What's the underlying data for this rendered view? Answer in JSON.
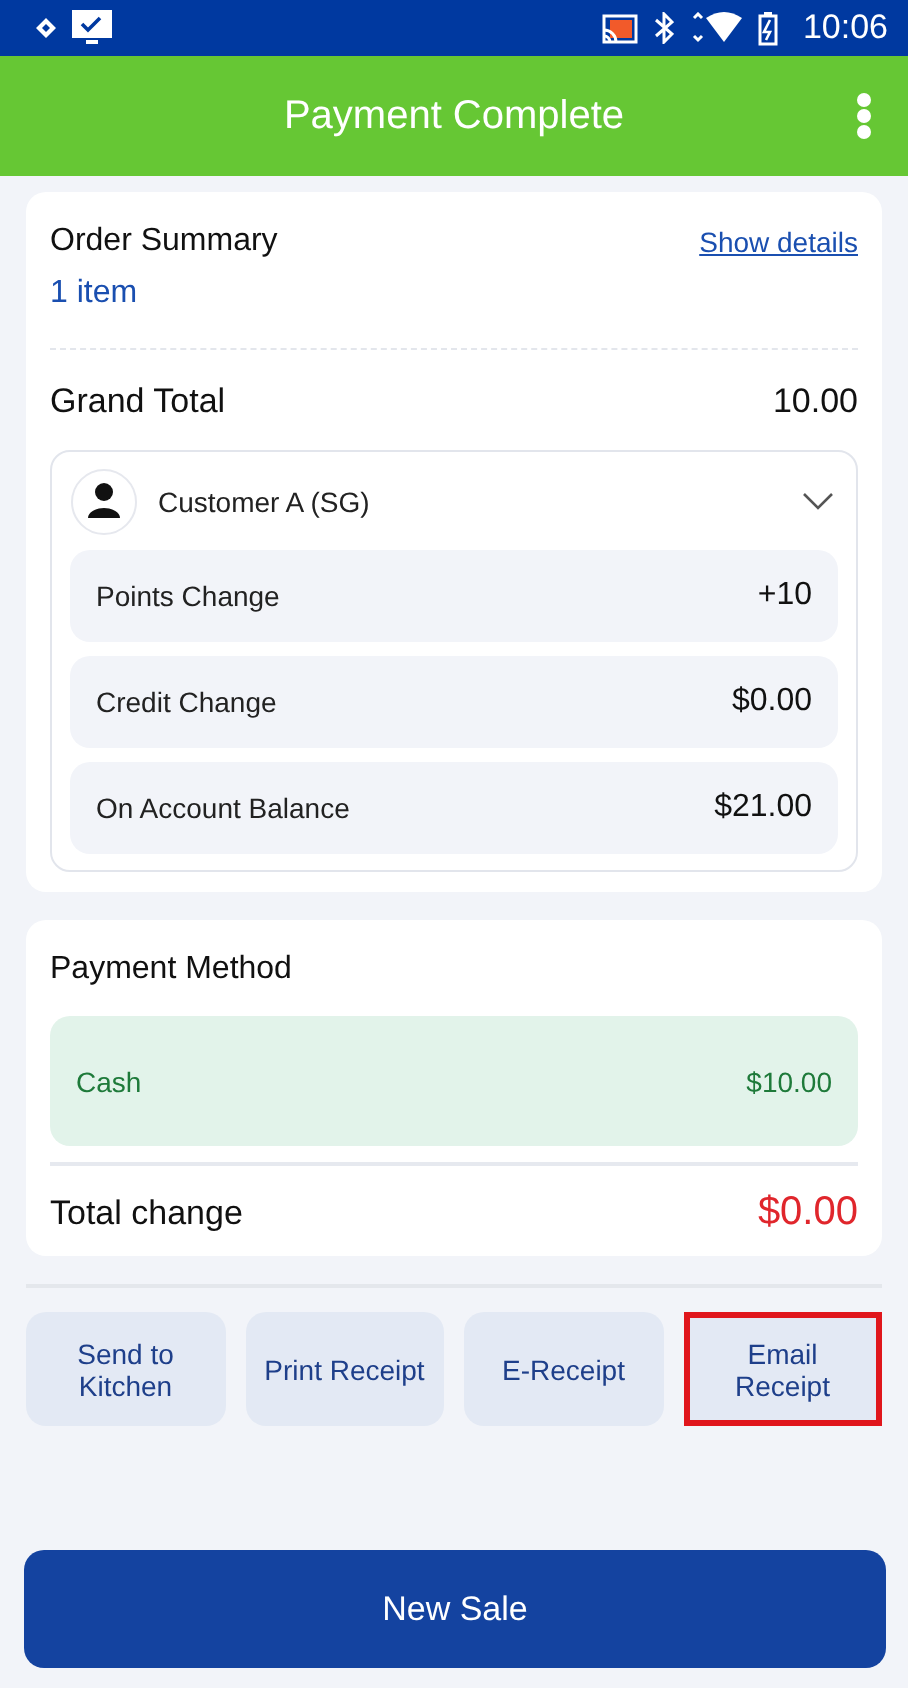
{
  "status_bar": {
    "time": "10:06"
  },
  "app_bar": {
    "title": "Payment Complete"
  },
  "order_summary": {
    "title": "Order Summary",
    "link": "Show details",
    "item_count": "1 item",
    "grand_total_label": "Grand Total",
    "grand_total": "10.00"
  },
  "customer": {
    "name": "Customer A (SG)",
    "expanded": true,
    "rows": [
      {
        "label": "Points Change",
        "value": "+10"
      },
      {
        "label": "Credit Change",
        "value": "$0.00"
      },
      {
        "label": "On Account Balance",
        "value": "$21.00"
      }
    ]
  },
  "payment": {
    "title": "Payment Method",
    "methods": [
      {
        "name": "Cash",
        "amount": "$10.00"
      }
    ],
    "total_change_label": "Total change",
    "total_change": "$0.00"
  },
  "actions": [
    {
      "label": "Send to Kitchen",
      "highlighted": false
    },
    {
      "label": "Print Receipt",
      "highlighted": false
    },
    {
      "label": "E-Receipt",
      "highlighted": false
    },
    {
      "label": "Email Receipt",
      "highlighted": true
    }
  ],
  "primary_button": "New Sale"
}
